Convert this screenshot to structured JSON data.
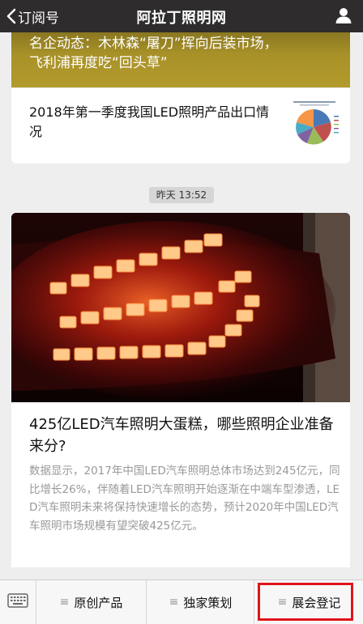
{
  "header": {
    "back_label": "订阅号",
    "title": "阿拉丁照明网"
  },
  "card1": {
    "banner_line1": "名企动态：木林森“屠刀”挥向后装市场，",
    "banner_line2": "飞利浦再度吃“回头草”",
    "sub_title": "2018年第一季度我国LED照明产品出口情况"
  },
  "timestamp": "昨天 13:52",
  "article": {
    "title": "425亿LED汽车照明大蛋糕，哪些照明企业准备来分?",
    "description": "数据显示，2017年中国LED汽车照明总体市场达到245亿元，同比增长26%，伴随着LED汽车照明开始逐渐在中端车型渗透，LED汽车照明未来将保持快速增长的态势，预计2020年中国LED汽车照明市场规模有望突破425亿元。"
  },
  "menu": {
    "items": [
      {
        "label": "原创产品"
      },
      {
        "label": "独家策划"
      },
      {
        "label": "展会登记"
      }
    ]
  },
  "colors": {
    "topbar": "#2e2c2d",
    "banner": "#a89128",
    "highlight": "#e0141b"
  }
}
